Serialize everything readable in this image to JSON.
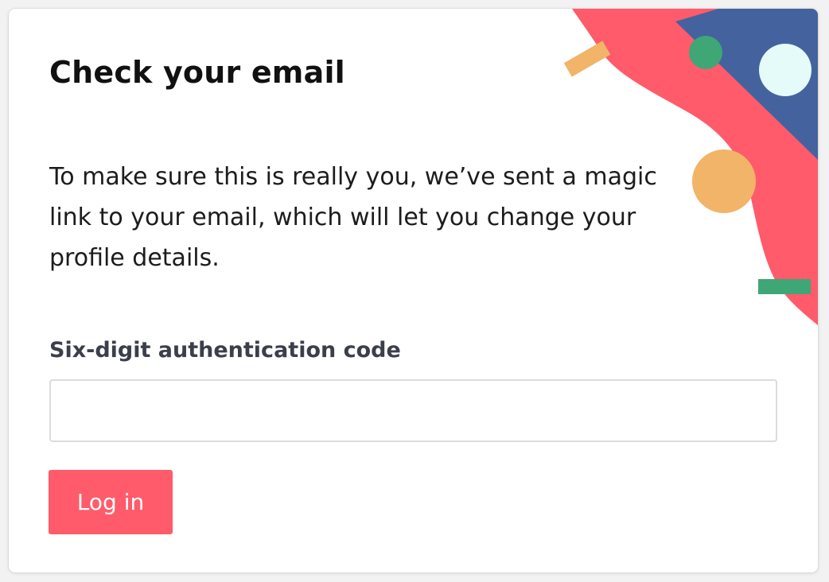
{
  "dialog": {
    "title": "Check your email",
    "description": "To make sure this is really you, we’ve sent a magic link to your email, which will let you change your profile details.",
    "code_label": "Six-digit authentication code",
    "code_value": "",
    "code_placeholder": "",
    "login_label": "Log in"
  },
  "colors": {
    "accent": "#ff5b6b",
    "decor_blue": "#44639e",
    "decor_green": "#3fa676",
    "decor_orange": "#f1b469",
    "decor_mint": "#e4fbfa"
  },
  "decor_shapes": [
    "pink-blob",
    "blue-band",
    "green-dot",
    "mint-circle",
    "orange-circle",
    "orange-bar",
    "green-bar"
  ]
}
